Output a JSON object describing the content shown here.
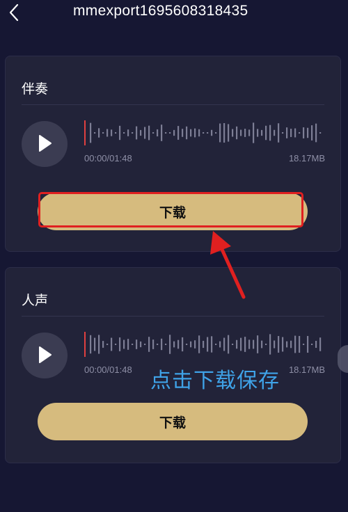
{
  "header": {
    "title": "mmexport1695608318435"
  },
  "tracks": [
    {
      "title": "伴奏",
      "time": "00:00/01:48",
      "size": "18.17MB",
      "download_label": "下载"
    },
    {
      "title": "人声",
      "time": "00:00/01:48",
      "size": "18.17MB",
      "download_label": "下载"
    }
  ],
  "annotation": {
    "caption": "点击下载保存"
  },
  "colors": {
    "background": "#161733",
    "card": "#222339",
    "button": "#d6bb7e",
    "highlight": "#e02020",
    "caption": "#3fa3e8"
  }
}
